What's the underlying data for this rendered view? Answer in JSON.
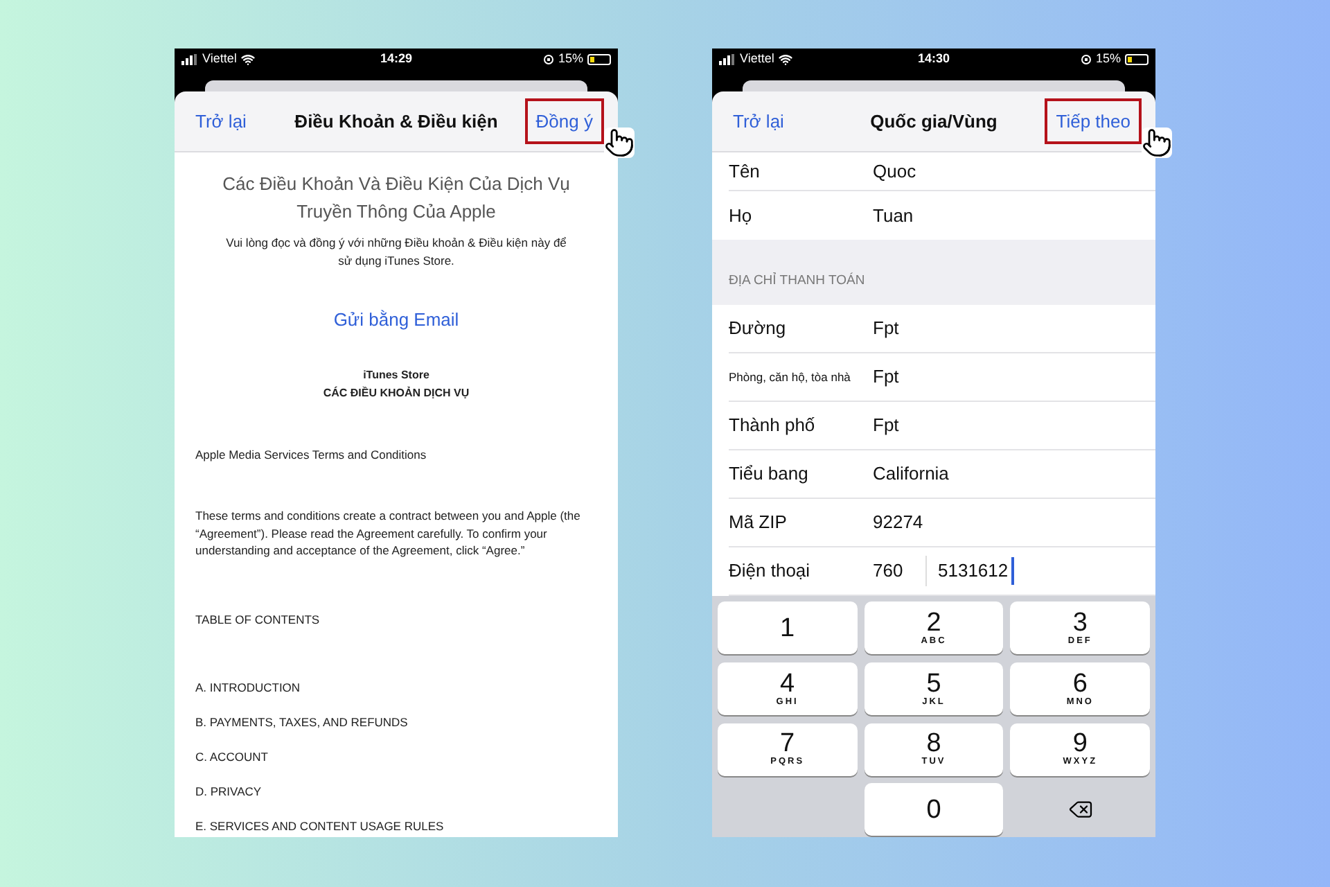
{
  "terms_screen": {
    "status": {
      "carrier": "Viettel",
      "time": "14:29",
      "battery": "15%"
    },
    "nav": {
      "back": "Trở lại",
      "title": "Điều Khoản & Điều kiện",
      "action": "Đồng ý",
      "action_highlighted": true
    },
    "heading": "Các Điều Khoản Và Điều Kiện Của Dịch Vụ Truyền Thông Của Apple",
    "intro": "Vui lòng đọc và đồng ý với những Điều khoản & Điều kiện này để sử dụng iTunes Store.",
    "email_link": "Gửi bằng Email",
    "store": "iTunes Store",
    "store_subtitle": "CÁC ĐIỀU KHOẢN DỊCH VỤ",
    "paragraphs": [
      "Apple Media Services Terms and Conditions",
      "These terms and conditions create a contract between you and Apple (the “Agreement”). Please read the Agreement carefully. To confirm your understanding and acceptance of the Agreement, click “Agree.”"
    ],
    "toc_title": "TABLE OF CONTENTS",
    "toc": [
      "A. INTRODUCTION",
      "B. PAYMENTS, TAXES, AND REFUNDS",
      "C. ACCOUNT",
      "D. PRIVACY",
      "E. SERVICES AND CONTENT USAGE RULES"
    ]
  },
  "address_screen": {
    "status": {
      "carrier": "Viettel",
      "time": "14:30",
      "battery": "15%"
    },
    "nav": {
      "back": "Trở lại",
      "title": "Quốc gia/Vùng",
      "action": "Tiếp theo",
      "action_highlighted": true
    },
    "name_rows": [
      {
        "label": "Tên",
        "value": "Quoc"
      },
      {
        "label": "Họ",
        "value": "Tuan"
      }
    ],
    "section_title": "ĐỊA CHỈ THANH TOÁN",
    "address_rows": [
      {
        "kind": "text",
        "label": "Đường",
        "value": "Fpt"
      },
      {
        "kind": "text_small_label",
        "label": "Phòng, căn hộ, tòa nhà",
        "value": "Fpt"
      },
      {
        "kind": "text",
        "label": "Thành phố",
        "value": "Fpt"
      },
      {
        "kind": "text",
        "label": "Tiểu bang",
        "value": "California"
      },
      {
        "kind": "text",
        "label": "Mã ZIP",
        "value": "92274"
      },
      {
        "kind": "phone",
        "label": "Điện thoại",
        "area_code": "760",
        "value": "5131612",
        "focused": true
      }
    ],
    "keypad": [
      {
        "kind": "digit",
        "digit": "1"
      },
      {
        "kind": "digit",
        "digit": "2",
        "letters": "ABC"
      },
      {
        "kind": "digit",
        "digit": "3",
        "letters": "DEF"
      },
      {
        "kind": "digit",
        "digit": "4",
        "letters": "GHI"
      },
      {
        "kind": "digit",
        "digit": "5",
        "letters": "JKL"
      },
      {
        "kind": "digit",
        "digit": "6",
        "letters": "MNO"
      },
      {
        "kind": "digit",
        "digit": "7",
        "letters": "PQRS"
      },
      {
        "kind": "digit",
        "digit": "8",
        "letters": "TUV"
      },
      {
        "kind": "digit",
        "digit": "9",
        "letters": "WXYZ"
      },
      {
        "kind": "blank"
      },
      {
        "kind": "digit",
        "digit": "0"
      },
      {
        "kind": "delete"
      }
    ]
  }
}
